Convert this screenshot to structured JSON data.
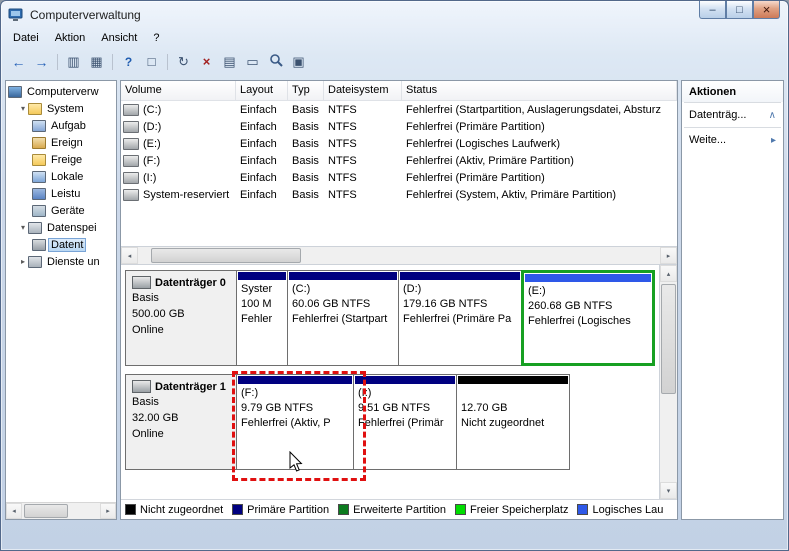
{
  "window": {
    "title": "Computerverwaltung",
    "controls": {
      "minimize": "–",
      "maximize": "□",
      "close": "×"
    }
  },
  "menu": {
    "items": [
      "Datei",
      "Aktion",
      "Ansicht",
      "?"
    ]
  },
  "toolbar": {
    "icons": [
      {
        "name": "back-icon",
        "glyph": "←"
      },
      {
        "name": "forward-icon",
        "glyph": "→"
      },
      {
        "name": "export-list-icon",
        "glyph": "▥"
      },
      {
        "name": "show-tree-icon",
        "glyph": "▦"
      },
      {
        "name": "help-icon",
        "glyph": "?"
      },
      {
        "name": "console-window-icon",
        "glyph": "□"
      },
      {
        "name": "refresh-icon",
        "glyph": "↻"
      },
      {
        "name": "delete-icon",
        "glyph": "×"
      },
      {
        "name": "properties-icon",
        "glyph": "▤"
      },
      {
        "name": "open-folder-icon",
        "glyph": "▭"
      },
      {
        "name": "search-icon",
        "glyph": ""
      },
      {
        "name": "monitor-icon",
        "glyph": "▣"
      }
    ]
  },
  "tree": {
    "items": [
      {
        "label": "Computerverw",
        "expander": ""
      },
      {
        "label": "System",
        "expander": "▾"
      },
      {
        "label": "Aufgab",
        "expander": ""
      },
      {
        "label": "Ereign",
        "expander": ""
      },
      {
        "label": "Freige",
        "expander": ""
      },
      {
        "label": "Lokale",
        "expander": ""
      },
      {
        "label": "Leistu",
        "expander": ""
      },
      {
        "label": "Geräte",
        "expander": ""
      },
      {
        "label": "Datenspei",
        "expander": "▾"
      },
      {
        "label": "Datent",
        "expander": ""
      },
      {
        "label": "Dienste un",
        "expander": "▸"
      }
    ]
  },
  "volumes": {
    "columns": [
      "Volume",
      "Layout",
      "Typ",
      "Dateisystem",
      "Status"
    ],
    "rows": [
      {
        "name": "(C:)",
        "layout": "Einfach",
        "typ": "Basis",
        "fs": "NTFS",
        "status": "Fehlerfrei (Startpartition, Auslagerungsdatei, Absturz"
      },
      {
        "name": "(D:)",
        "layout": "Einfach",
        "typ": "Basis",
        "fs": "NTFS",
        "status": "Fehlerfrei (Primäre Partition)"
      },
      {
        "name": "(E:)",
        "layout": "Einfach",
        "typ": "Basis",
        "fs": "NTFS",
        "status": "Fehlerfrei (Logisches Laufwerk)"
      },
      {
        "name": "(F:)",
        "layout": "Einfach",
        "typ": "Basis",
        "fs": "NTFS",
        "status": "Fehlerfrei (Aktiv, Primäre Partition)"
      },
      {
        "name": "(I:)",
        "layout": "Einfach",
        "typ": "Basis",
        "fs": "NTFS",
        "status": "Fehlerfrei (Primäre Partition)"
      },
      {
        "name": "System-reserviert",
        "layout": "Einfach",
        "typ": "Basis",
        "fs": "NTFS",
        "status": "Fehlerfrei (System, Aktiv, Primäre Partition)"
      }
    ]
  },
  "disks": [
    {
      "name": "Datenträger 0",
      "kind": "Basis",
      "size": "500.00 GB",
      "status": "Online",
      "partitions": [
        {
          "title": "Syster",
          "line1": "100 M",
          "line2": "Fehler"
        },
        {
          "title": "(C:)",
          "line1": "60.06 GB NTFS",
          "line2": "Fehlerfrei (Startpart"
        },
        {
          "title": "(D:)",
          "line1": "179.16 GB NTFS",
          "line2": "Fehlerfrei (Primäre Pa"
        },
        {
          "title": "(E:)",
          "line1": "260.68 GB NTFS",
          "line2": "Fehlerfrei (Logisches"
        }
      ]
    },
    {
      "name": "Datenträger 1",
      "kind": "Basis",
      "size": "32.00 GB",
      "status": "Online",
      "partitions": [
        {
          "title": "(F:)",
          "line1": "9.79 GB NTFS",
          "line2": "Fehlerfrei (Aktiv, P"
        },
        {
          "title": "(I:)",
          "line1": "9.51 GB NTFS",
          "line2": "Fehlerfrei (Primär"
        },
        {
          "title": "",
          "line1": "12.70 GB",
          "line2": "Nicht zugeordnet"
        }
      ]
    }
  ],
  "legend": {
    "items": [
      {
        "label": "Nicht zugeordnet",
        "color": "#000000"
      },
      {
        "label": "Primäre Partition",
        "color": "#000080"
      },
      {
        "label": "Erweiterte Partition",
        "color": "#0b7b1e"
      },
      {
        "label": "Freier Speicherplatz",
        "color": "#00dd00"
      },
      {
        "label": "Logisches Lau",
        "color": "#2e58e8"
      }
    ]
  },
  "actions": {
    "header": "Aktionen",
    "items": [
      {
        "label": "Datenträg...",
        "chevron": "∧"
      },
      {
        "label": "Weite...",
        "chevron": "▸"
      }
    ]
  },
  "colors": {
    "primary_partition": "#000080",
    "logical_drive": "#2e58e8",
    "extended_border": "#17a022",
    "unallocated": "#000000",
    "annotation_dashed": "#e01010"
  }
}
